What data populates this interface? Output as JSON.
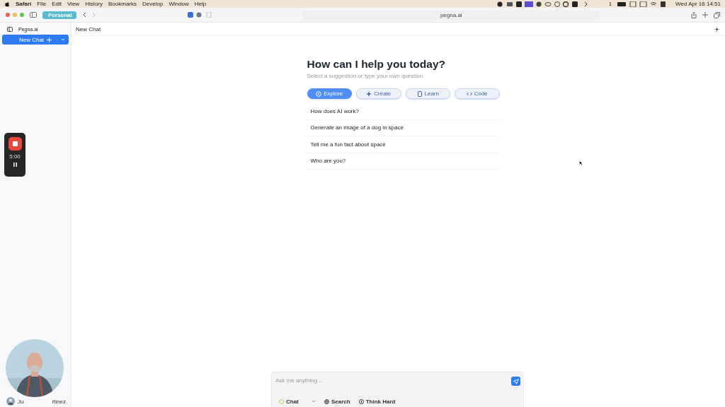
{
  "menu_bar": {
    "app": "Safari",
    "items": [
      "File",
      "Edit",
      "View",
      "History",
      "Bookmarks",
      "Develop",
      "Window",
      "Help"
    ],
    "clock": "Wed Apr 16  14:51",
    "badge": "1"
  },
  "browser": {
    "profile": "Personal",
    "address": "pegna.ai"
  },
  "sidebar": {
    "title": "Pegna.ai",
    "new_chat": "New Chat"
  },
  "header": {
    "title": "New Chat"
  },
  "welcome": {
    "heading": "How can I help you today?",
    "subheading": "Select a suggestion or type your own question"
  },
  "categories": [
    {
      "label": "Explore",
      "selected": true
    },
    {
      "label": "Create",
      "selected": false
    },
    {
      "label": "Learn",
      "selected": false
    },
    {
      "label": "Code",
      "selected": false
    }
  ],
  "suggestions": [
    "How does AI work?",
    "Generate an image of a dog in space",
    "Tell me a fun fact about space",
    "Who are you?"
  ],
  "composer": {
    "placeholder": "Ask me anything...",
    "mode": "Chat",
    "tools": [
      "Search",
      "Think Hard"
    ]
  },
  "recorder": {
    "time": "5:00"
  },
  "webcam": {
    "kind": "picture",
    "name_start": "Ju",
    "name_end": "rtinez"
  }
}
